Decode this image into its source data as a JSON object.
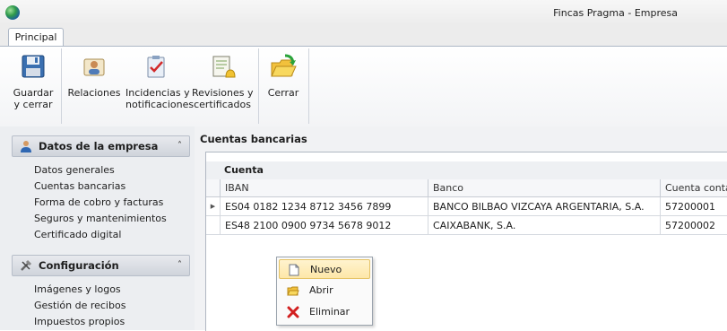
{
  "window": {
    "title": "Fincas Pragma - Empresa"
  },
  "tabs": [
    {
      "label": "Principal",
      "active": true
    }
  ],
  "ribbon": {
    "buttons": [
      {
        "id": "guardar",
        "label": "Guardar\ny cerrar",
        "icon": "floppy-disk-icon"
      },
      {
        "id": "relaciones",
        "label": "Relaciones",
        "icon": "contacts-card-icon"
      },
      {
        "id": "incidencias",
        "label": "Incidencias y\nnotificaciones",
        "icon": "clipboard-check-icon"
      },
      {
        "id": "revisiones",
        "label": "Revisiones y\ncertificados",
        "icon": "notepad-bell-icon"
      },
      {
        "id": "cerrar",
        "label": "Cerrar",
        "icon": "folder-open-arrow-icon"
      }
    ]
  },
  "sidebar": {
    "groups": [
      {
        "title": "Datos de la empresa",
        "icon": "person-icon",
        "expanded": true,
        "items": [
          "Datos generales",
          "Cuentas bancarias",
          "Forma de cobro y facturas",
          "Seguros y mantenimientos",
          "Certificado digital"
        ]
      },
      {
        "title": "Configuración",
        "icon": "tools-icon",
        "expanded": true,
        "items": [
          "Imágenes y logos",
          "Gestión de recibos",
          "Impuestos propios"
        ]
      }
    ]
  },
  "main": {
    "section_title": "Cuentas bancarias",
    "grid": {
      "band_label": "Cuenta",
      "columns": [
        "IBAN",
        "Banco",
        "Cuenta contab"
      ],
      "rows": [
        {
          "iban": "ES04 0182 1234 8712 3456 7899",
          "banco": "BANCO BILBAO VIZCAYA ARGENTARIA, S.A.",
          "cuenta": "57200001",
          "current": true
        },
        {
          "iban": "ES48 2100 0900 9734 5678 9012",
          "banco": "CAIXABANK, S.A.",
          "cuenta": "57200002",
          "current": false
        }
      ]
    }
  },
  "context_menu": {
    "items": [
      {
        "label": "Nuevo",
        "icon": "new-document-icon",
        "highlighted": true
      },
      {
        "label": "Abrir",
        "icon": "open-folder-icon",
        "highlighted": false
      },
      {
        "label": "Eliminar",
        "icon": "delete-x-icon",
        "highlighted": false
      }
    ]
  },
  "colors": {
    "accent_highlight": "#fde7a8",
    "delete_red": "#d21f1f",
    "folder_yellow": "#f2c13c"
  }
}
